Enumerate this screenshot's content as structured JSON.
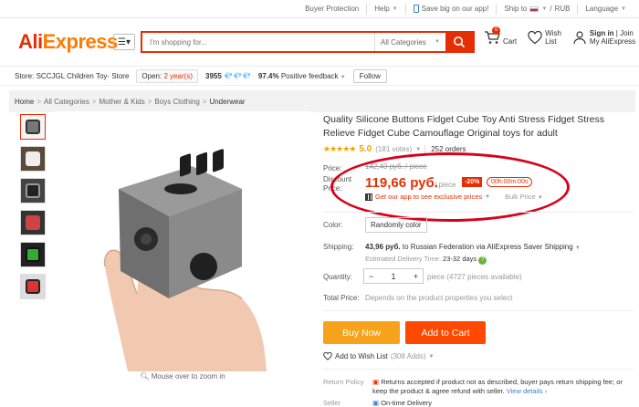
{
  "topbar": {
    "protection": "Buyer Protection",
    "help": "Help",
    "app": "Save big on our app!",
    "ship_to": "Ship to",
    "currency": "RUB",
    "language": "Language"
  },
  "header": {
    "logo_a": "Ali",
    "logo_b": "Express",
    "search_placeholder": "I'm shopping for...",
    "category": "All Categories",
    "cart_label": "Cart",
    "cart_count": "0",
    "wish_label_1": "Wish",
    "wish_label_2": "List",
    "signin": "Sign in",
    "join": "Join",
    "myali": "My AliExpress"
  },
  "store": {
    "label": "Store:",
    "name": "SCCJGL Children Toy- Store",
    "open_label": "Open:",
    "open_years": "2 year(s)",
    "score": "3955",
    "diamonds": "💎💎💎",
    "feedback_pct": "97.4%",
    "feedback_label": "Positive feedback",
    "follow": "Follow"
  },
  "breadcrumb": [
    "Home",
    "All Categories",
    "Mother & Kids",
    "Boys Clothing",
    "Underwear"
  ],
  "product": {
    "title": "Quality Silicone Buttons Fidget Cube Toy Anti Stress Fidget Stress Relieve Fidget Cube Camouflage Original toys for adult",
    "stars": "★★★★★",
    "rating": "5.0",
    "votes": "(181 votes)",
    "orders": "252 orders",
    "price_label": "Price:",
    "price_old": "142,40 руб. / piece",
    "discount_label_1": "Discount",
    "discount_label_2": "Price:",
    "price_new": "119,66 руб.",
    "per_piece": "/ piece",
    "discount": "-20%",
    "timer": "00h:00m:00s",
    "app_offer": "Get our app to see exclusive prices",
    "bulk": "Bulk Price",
    "color_label": "Color:",
    "color_value": "Randomly color",
    "shipping_label": "Shipping:",
    "shipping_cost": "43,96 руб.",
    "shipping_to": "to Russian Federation via AliExpress Saver Shipping",
    "delivery_label": "Estimated Delivery Time:",
    "delivery_days": "23-32 days",
    "qty_label": "Quantity:",
    "qty_value": "1",
    "qty_avail": "piece (4727 pieces available)",
    "total_label": "Total Price:",
    "total_value": "Depends on the product properties you select",
    "buy_now": "Buy Now",
    "add_cart": "Add to Cart",
    "wish": "Add to Wish List",
    "wish_count": "(308 Adds)",
    "zoom_hint": "Mouse over to zoom in",
    "return_label": "Return Policy",
    "return_text": "Returns accepted if product not as described, buyer pays return shipping fee; or keep the product & agree refund with seller.",
    "view_details": "View details",
    "seller_label": "Seller",
    "ontime": "On-time Delivery"
  }
}
